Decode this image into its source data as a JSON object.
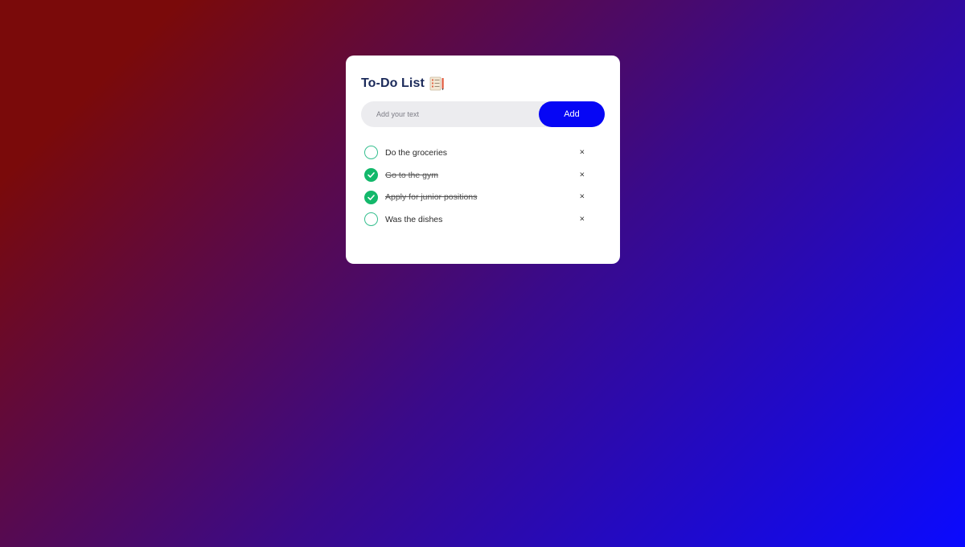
{
  "app": {
    "title": "To-Do List",
    "title_icon": "checklist-icon"
  },
  "input": {
    "placeholder": "Add your text",
    "value": ""
  },
  "add_button": {
    "label": "Add"
  },
  "tasks": [
    {
      "text": "Do the groceries",
      "done": false
    },
    {
      "text": "Go to the gym",
      "done": true
    },
    {
      "text": "Apply for junior positions",
      "done": true
    },
    {
      "text": "Was the dishes",
      "done": false
    }
  ],
  "delete_glyph": "×",
  "colors": {
    "accent": "#0606f5",
    "check_done": "#13b86b",
    "check_outline": "#36bf8f",
    "title": "#1b2a5a",
    "gradient_start": "#7a0a0a",
    "gradient_end": "#0a0aff"
  }
}
